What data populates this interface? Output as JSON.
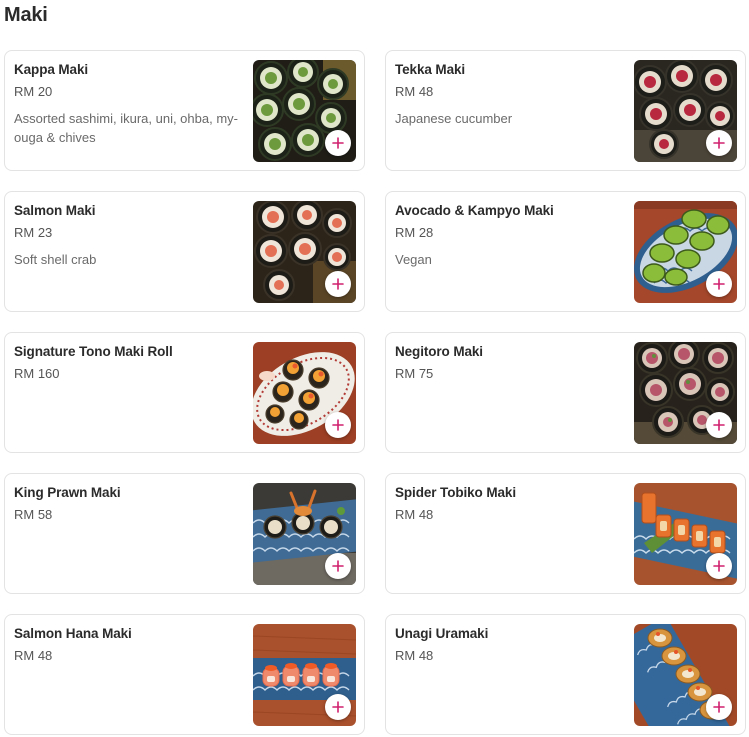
{
  "section": {
    "title": "Maki"
  },
  "colors": {
    "accent": "#d0206e",
    "card_border": "#e3e3e3"
  },
  "items": [
    {
      "name": "Kappa Maki",
      "price": "RM 20",
      "description": "Assorted sashimi, ikura, uni, ohba, my-ouga & chives",
      "image": "kappa-maki-photo",
      "add_icon": "plus-icon"
    },
    {
      "name": "Tekka Maki",
      "price": "RM 48",
      "description": "Japanese cucumber",
      "image": "tekka-maki-photo",
      "add_icon": "plus-icon"
    },
    {
      "name": "Salmon Maki",
      "price": "RM 23",
      "description": "Soft shell crab",
      "image": "salmon-maki-photo",
      "add_icon": "plus-icon"
    },
    {
      "name": "Avocado & Kampyo Maki",
      "price": "RM 28",
      "description": "Vegan",
      "image": "avocado-kampyo-maki-photo",
      "add_icon": "plus-icon"
    },
    {
      "name": "Signature Tono Maki Roll",
      "price": "RM 160",
      "description": "",
      "image": "signature-tono-maki-roll-photo",
      "add_icon": "plus-icon"
    },
    {
      "name": "Negitoro Maki",
      "price": "RM 75",
      "description": "",
      "image": "negitoro-maki-photo",
      "add_icon": "plus-icon"
    },
    {
      "name": "King Prawn Maki",
      "price": "RM 58",
      "description": "",
      "image": "king-prawn-maki-photo",
      "add_icon": "plus-icon"
    },
    {
      "name": "Spider Tobiko Maki",
      "price": "RM 48",
      "description": "",
      "image": "spider-tobiko-maki-photo",
      "add_icon": "plus-icon"
    },
    {
      "name": "Salmon Hana Maki",
      "price": "RM 48",
      "description": "",
      "image": "salmon-hana-maki-photo",
      "add_icon": "plus-icon"
    },
    {
      "name": "Unagi Uramaki",
      "price": "RM 48",
      "description": "",
      "image": "unagi-uramaki-photo",
      "add_icon": "plus-icon"
    }
  ]
}
